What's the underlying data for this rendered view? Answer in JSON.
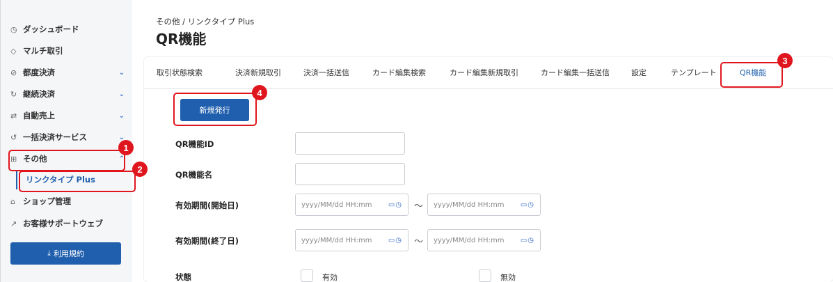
{
  "sidebar": {
    "items": [
      {
        "icon": "clock-icon",
        "glyph": "◷",
        "label": "ダッシュボード"
      },
      {
        "icon": "cube-icon",
        "glyph": "◇",
        "label": "マルチ取引"
      },
      {
        "icon": "check-circle-icon",
        "glyph": "⊘",
        "label": "都度決済"
      },
      {
        "icon": "refresh-icon",
        "glyph": "↻",
        "label": "継続決済"
      },
      {
        "icon": "swap-icon",
        "glyph": "⇄",
        "label": "自動売上"
      },
      {
        "icon": "cycle-icon",
        "glyph": "↺",
        "label": "一括決済サービス"
      },
      {
        "icon": "grid-icon",
        "glyph": "⊞",
        "label": "その他"
      },
      {
        "icon": "shop-icon",
        "glyph": "⌂",
        "label": "ショップ管理"
      },
      {
        "icon": "external-link-icon",
        "glyph": "↗",
        "label": "お客様サポートウェブ"
      }
    ],
    "sub_item": "リンクタイプ Plus",
    "terms_button": "利用規約",
    "terms_icon": "⤓"
  },
  "header": {
    "breadcrumb": "その他 / リンクタイプ Plus",
    "title": "QR機能"
  },
  "tabs": [
    "取引状態検索",
    "決済新規取引",
    "決済一括送信",
    "カード編集検索",
    "カード編集新規取引",
    "カード編集一括送信",
    "設定",
    "テンプレート",
    "QR機能"
  ],
  "active_tab": "QR機能",
  "form": {
    "new_button": "新規発行",
    "qr_id_label": "QR機能ID",
    "qr_name_label": "QR機能名",
    "start_label": "有効期間(開始日)",
    "end_label": "有効期間(終了日)",
    "date_placeholder": "yyyy/MM/dd HH:mm",
    "range_sep": "～",
    "status_label": "状態",
    "status_valid": "有効",
    "status_invalid": "無効"
  },
  "annotations": [
    "1",
    "2",
    "3",
    "4"
  ],
  "colors": {
    "accent": "#1f5fad",
    "annotation": "#e0161e"
  }
}
